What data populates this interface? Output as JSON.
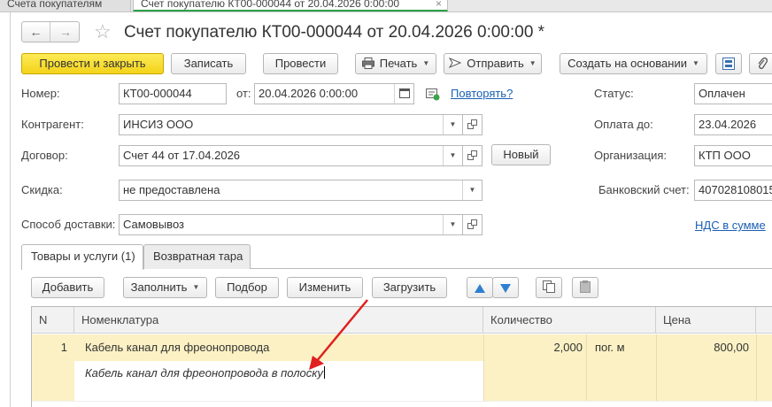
{
  "window_tabs": [
    {
      "label": "Счета покупателям"
    },
    {
      "label": "Счет покупателю КТ00-000044 от 20.04.2026 0:00:00",
      "close": "×"
    }
  ],
  "nav": {
    "back": "←",
    "forward": "→",
    "star": "☆"
  },
  "title": "Счет покупателю КТ00-000044 от 20.04.2026 0:00:00 *",
  "toolbar": {
    "post_close": "Провести и закрыть",
    "save": "Записать",
    "post": "Провести",
    "print": "Печать",
    "send": "Отправить",
    "create_based": "Создать на основании"
  },
  "form": {
    "number_label": "Номер:",
    "number_value": "КТ00-000044",
    "date_label": "от:",
    "date_value": "20.04.2026  0:00:00",
    "repeat_link": "Повторять?",
    "counterparty_label": "Контрагент:",
    "counterparty_value": "ИНСИЗ ООО",
    "contract_label": "Договор:",
    "contract_value": "Счет 44 от 17.04.2026",
    "new_button": "Новый",
    "discount_label": "Скидка:",
    "discount_value": "не предоставлена",
    "delivery_label": "Способ доставки:",
    "delivery_value": "Самовывоз",
    "status_label": "Статус:",
    "status_value": "Оплачен",
    "pay_until_label": "Оплата до:",
    "pay_until_value": "23.04.2026",
    "org_label": "Организация:",
    "org_value": "КТП ООО",
    "bank_label": "Банковский счет:",
    "bank_value": "407028108015",
    "vat_link": "НДС в сумме"
  },
  "tabs": [
    {
      "label": "Товары и услуги (1)"
    },
    {
      "label": "Возвратная тара"
    }
  ],
  "table_toolbar": {
    "add": "Добавить",
    "fill": "Заполнить",
    "select": "Подбор",
    "change": "Изменить",
    "load": "Загрузить"
  },
  "table": {
    "columns": [
      "N",
      "Номенклатура",
      "Количество",
      "Цена"
    ],
    "rows": [
      {
        "n": "1",
        "item": "Кабель канал для фреонопровода",
        "qty": "2,000",
        "unit": "пог. м",
        "price": "800,00",
        "description": "Кабель канал для фреонопровода в полоску"
      }
    ]
  },
  "colors": {
    "primary_button": "#f3d21a",
    "selected_row": "#fbf1c4",
    "link": "#1a5fb4",
    "active_tab_underline": "#2aa14a",
    "annotation_arrow": "#e02020"
  }
}
